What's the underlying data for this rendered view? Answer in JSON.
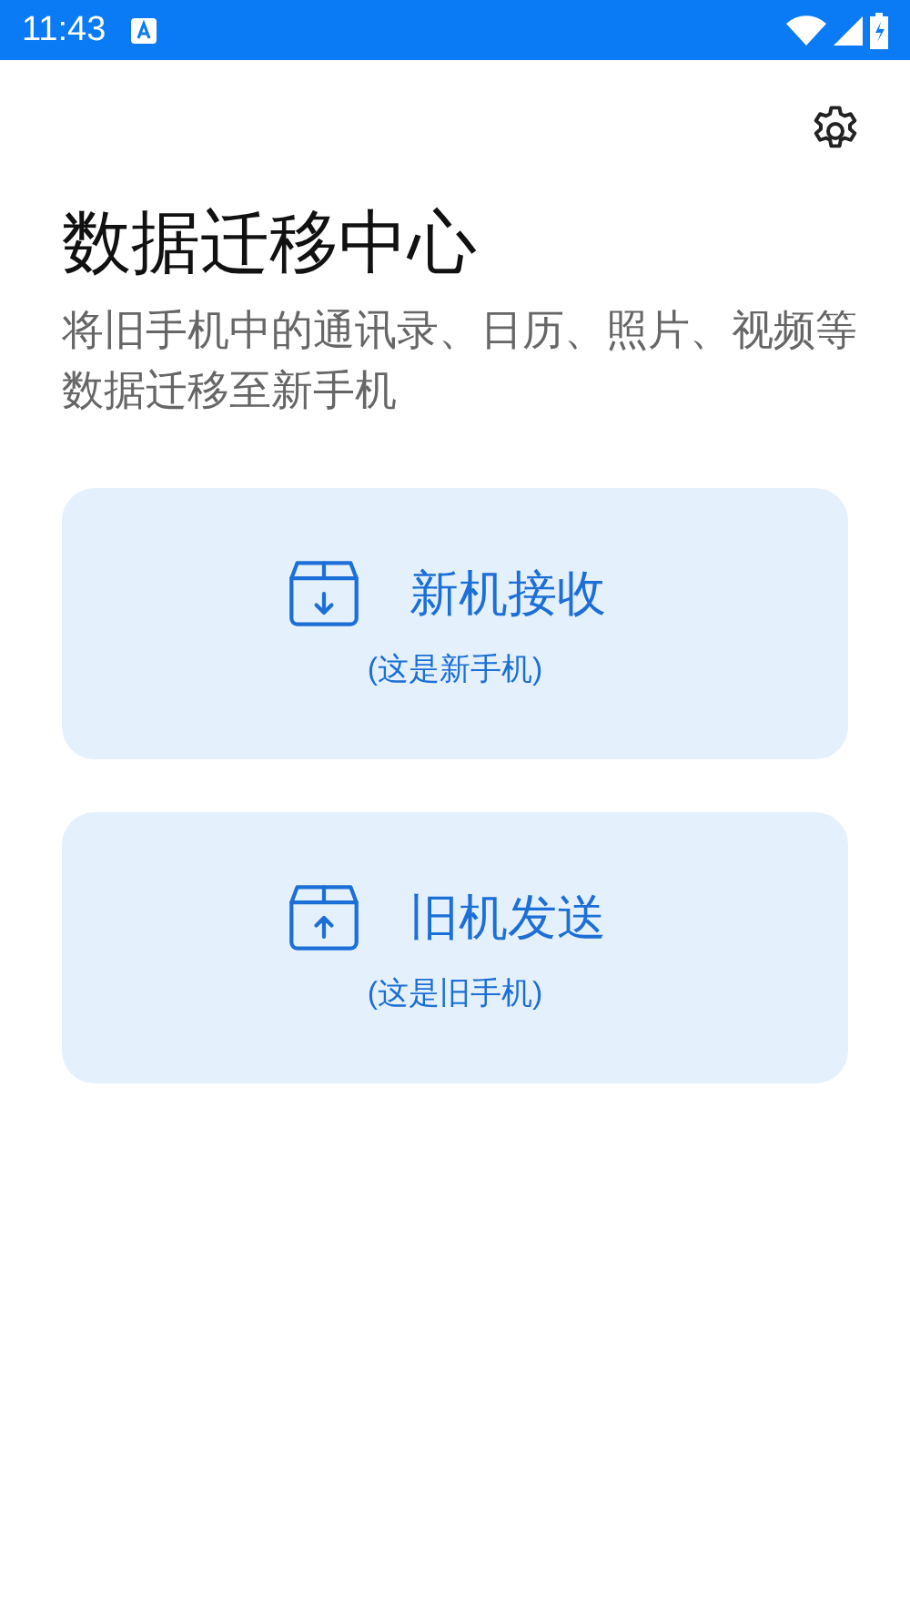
{
  "status_bar": {
    "time": "11:43"
  },
  "title": "数据迁移中心",
  "subtitle": "将旧手机中的通讯录、日历、照片、视频等数据迁移至新手机",
  "options": [
    {
      "kind": "receive",
      "label": "新机接收",
      "note": "(这是新手机)"
    },
    {
      "kind": "send",
      "label": "旧机发送",
      "note": "(这是旧手机)"
    }
  ]
}
